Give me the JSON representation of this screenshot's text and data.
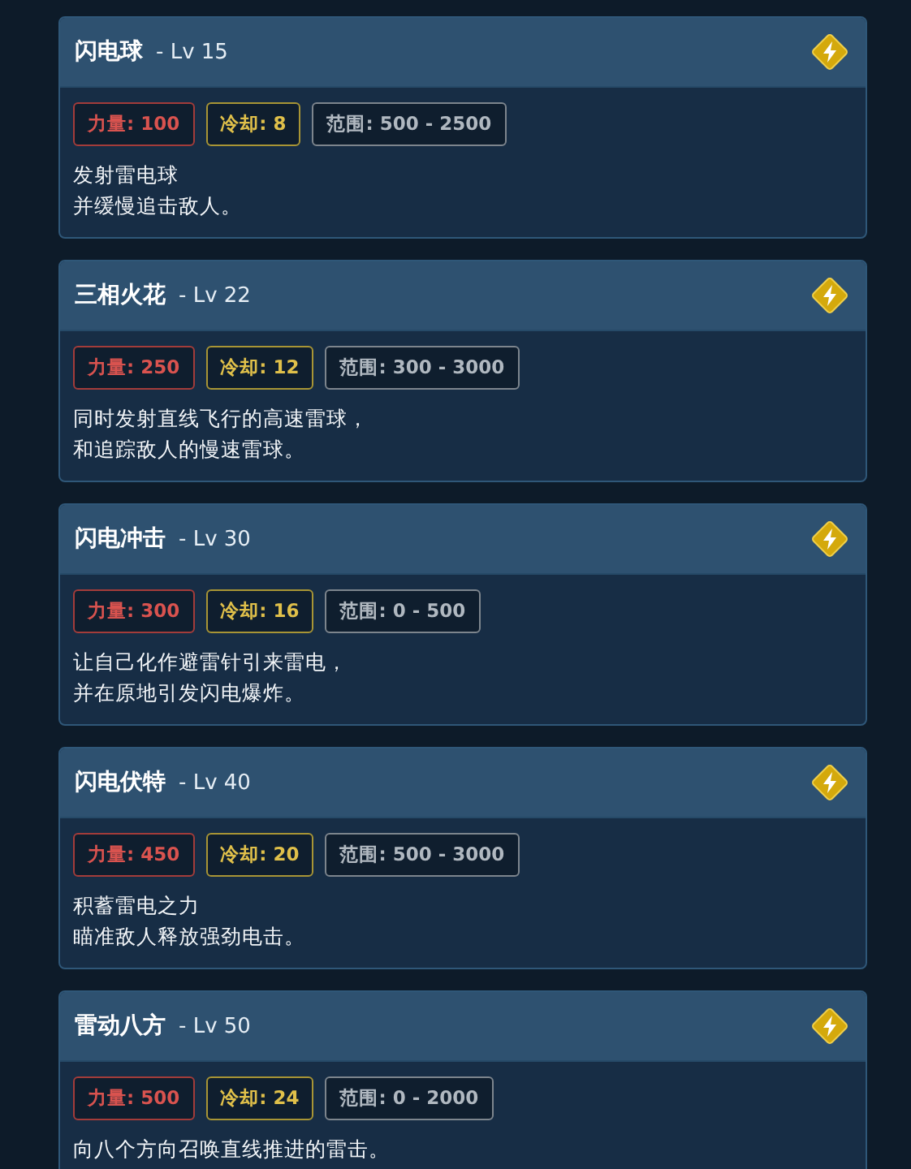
{
  "skills": [
    {
      "name": "闪电球",
      "level": "- Lv 15",
      "stats": [
        {
          "kind": "power",
          "text": "力量: 100"
        },
        {
          "kind": "cooldown",
          "text": "冷却: 8"
        },
        {
          "kind": "range",
          "text": "范围: 500 - 2500"
        }
      ],
      "lines": [
        "发射雷电球",
        "并缓慢追击敌人。"
      ]
    },
    {
      "name": "三相火花",
      "level": "- Lv 22",
      "stats": [
        {
          "kind": "power",
          "text": "力量: 250"
        },
        {
          "kind": "cooldown",
          "text": "冷却: 12"
        },
        {
          "kind": "range",
          "text": "范围: 300 - 3000"
        }
      ],
      "lines": [
        "同时发射直线飞行的高速雷球，",
        "和追踪敌人的慢速雷球。"
      ]
    },
    {
      "name": "闪电冲击",
      "level": "- Lv 30",
      "stats": [
        {
          "kind": "power",
          "text": "力量: 300"
        },
        {
          "kind": "cooldown",
          "text": "冷却: 16"
        },
        {
          "kind": "range",
          "text": "范围: 0 - 500"
        }
      ],
      "lines": [
        "让自己化作避雷针引来雷电，",
        "并在原地引发闪电爆炸。"
      ]
    },
    {
      "name": "闪电伏特",
      "level": "- Lv 40",
      "stats": [
        {
          "kind": "power",
          "text": "力量: 450"
        },
        {
          "kind": "cooldown",
          "text": "冷却: 20"
        },
        {
          "kind": "range",
          "text": "范围: 500 - 3000"
        }
      ],
      "lines": [
        "积蓄雷电之力",
        "瞄准敌人释放强劲电击。"
      ]
    },
    {
      "name": "雷动八方",
      "level": "- Lv 50",
      "stats": [
        {
          "kind": "power",
          "text": "力量: 500"
        },
        {
          "kind": "cooldown",
          "text": "冷却: 24"
        },
        {
          "kind": "range",
          "text": "范围: 0 - 2000"
        }
      ],
      "lines": [
        "向八个方向召唤直线推进的雷击。"
      ]
    }
  ]
}
